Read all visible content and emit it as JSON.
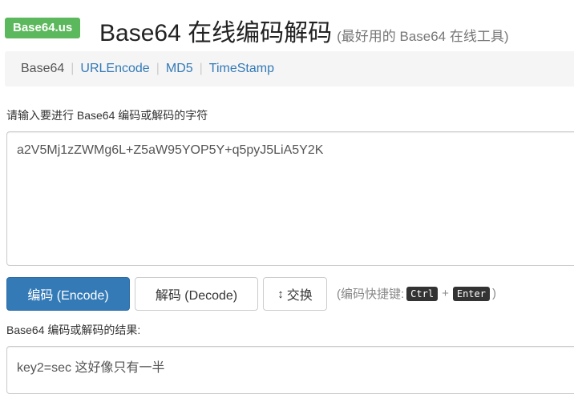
{
  "header": {
    "brand": "Base64.us",
    "title": "Base64 在线编码解码",
    "subtitle": "(最好用的 Base64 在线工具)"
  },
  "nav": {
    "items": [
      {
        "label": "Base64"
      },
      {
        "label": "URLEncode"
      },
      {
        "label": "MD5"
      },
      {
        "label": "TimeStamp"
      }
    ],
    "separator": "|"
  },
  "input": {
    "label": "请输入要进行 Base64 编码或解码的字符",
    "value": "a2V5Mj1zZWMg6L+Z5aW95YOP5Y+q5pyJ5LiA5Y2K"
  },
  "buttons": {
    "encode": "编码 (Encode)",
    "decode": "解码 (Decode)",
    "swap_icon": "↕",
    "swap": "交换"
  },
  "shortcut": {
    "prefix": "(编码快捷键:",
    "key1": "Ctrl",
    "plus": "+",
    "key2": "Enter",
    "suffix": ")"
  },
  "result": {
    "label": "Base64 编码或解码的结果:",
    "value": "key2=sec 这好像只有一半"
  },
  "colors": {
    "brand_green": "#5cb85c",
    "primary_blue": "#337ab7",
    "link_blue": "#337ab7"
  }
}
